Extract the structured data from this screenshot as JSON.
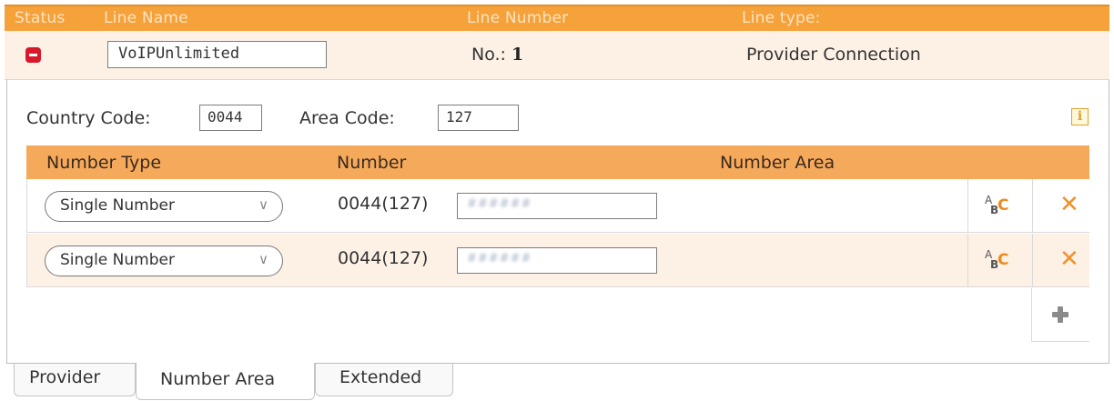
{
  "header": {
    "status": "Status",
    "line_name": "Line Name",
    "line_number": "Line Number",
    "line_type": "Line type:"
  },
  "line": {
    "name_value": "VoIPUnlimited",
    "number_label": "No.: ",
    "number_value": "1",
    "type": "Provider Connection"
  },
  "codes": {
    "country_label": "Country Code:",
    "country_value": "0044",
    "area_label": "Area Code:",
    "area_value": "127"
  },
  "info_icon": "i",
  "table": {
    "headers": {
      "number_type": "Number Type",
      "number": "Number",
      "number_area": "Number Area"
    },
    "rows": [
      {
        "type": "Single Number",
        "prefix": "0044(127)",
        "number": "######"
      },
      {
        "type": "Single Number",
        "prefix": "0044(127)",
        "number": "######"
      }
    ]
  },
  "colors": {
    "header_bar": "#f5a23b",
    "table_header": "#f5a95b",
    "row_alt": "#fdf1e6",
    "status_red": "#d8192c",
    "delete_orange": "#f0922b"
  },
  "tabs": [
    {
      "label": "Provider",
      "active": false
    },
    {
      "label": "Number Area",
      "active": true
    },
    {
      "label": "Extended",
      "active": false
    }
  ]
}
